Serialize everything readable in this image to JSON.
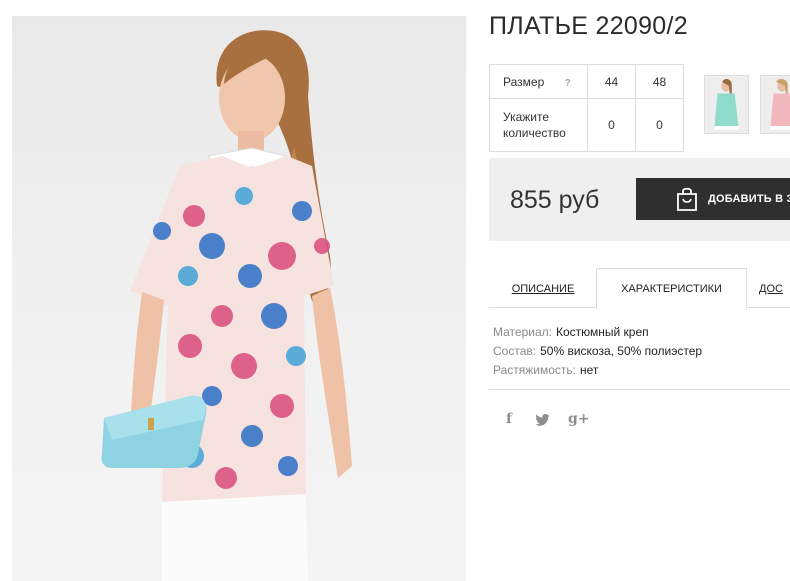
{
  "product": {
    "title": "ПЛАТЬЕ 22090/2",
    "price": "855 руб"
  },
  "sizes": {
    "size_label": "Размер",
    "help_icon": "?",
    "values": [
      "44",
      "48"
    ],
    "qty_label": "Укажите количество",
    "quantities": [
      "0",
      "0"
    ]
  },
  "thumbnails": [
    {
      "icon": "thumbnail-mint-dress",
      "color": "#8fdccb"
    },
    {
      "icon": "thumbnail-pink-dress",
      "color": "#f2b8bd"
    }
  ],
  "cart": {
    "label": "ДОБАВИТЬ В З",
    "icon": "shopping-bag-icon"
  },
  "tabs": [
    {
      "label": "ОПИСАНИЕ",
      "active": false
    },
    {
      "label": "ХАРАКТЕРИСТИКИ",
      "active": true
    },
    {
      "label": "ДОС",
      "active": false
    }
  ],
  "specs": [
    {
      "key": "Материал:",
      "value": "Костюмный креп"
    },
    {
      "key": "Состав:",
      "value": "50% вискоза, 50% полиэстер"
    },
    {
      "key": "Растяжимость:",
      "value": "нет"
    }
  ],
  "social": {
    "facebook": "f",
    "twitter": "t",
    "googleplus": "g+"
  },
  "colors": {
    "button_bg": "#2f2f2f",
    "price_box_bg": "#efefef",
    "border": "#dcdcdc"
  }
}
